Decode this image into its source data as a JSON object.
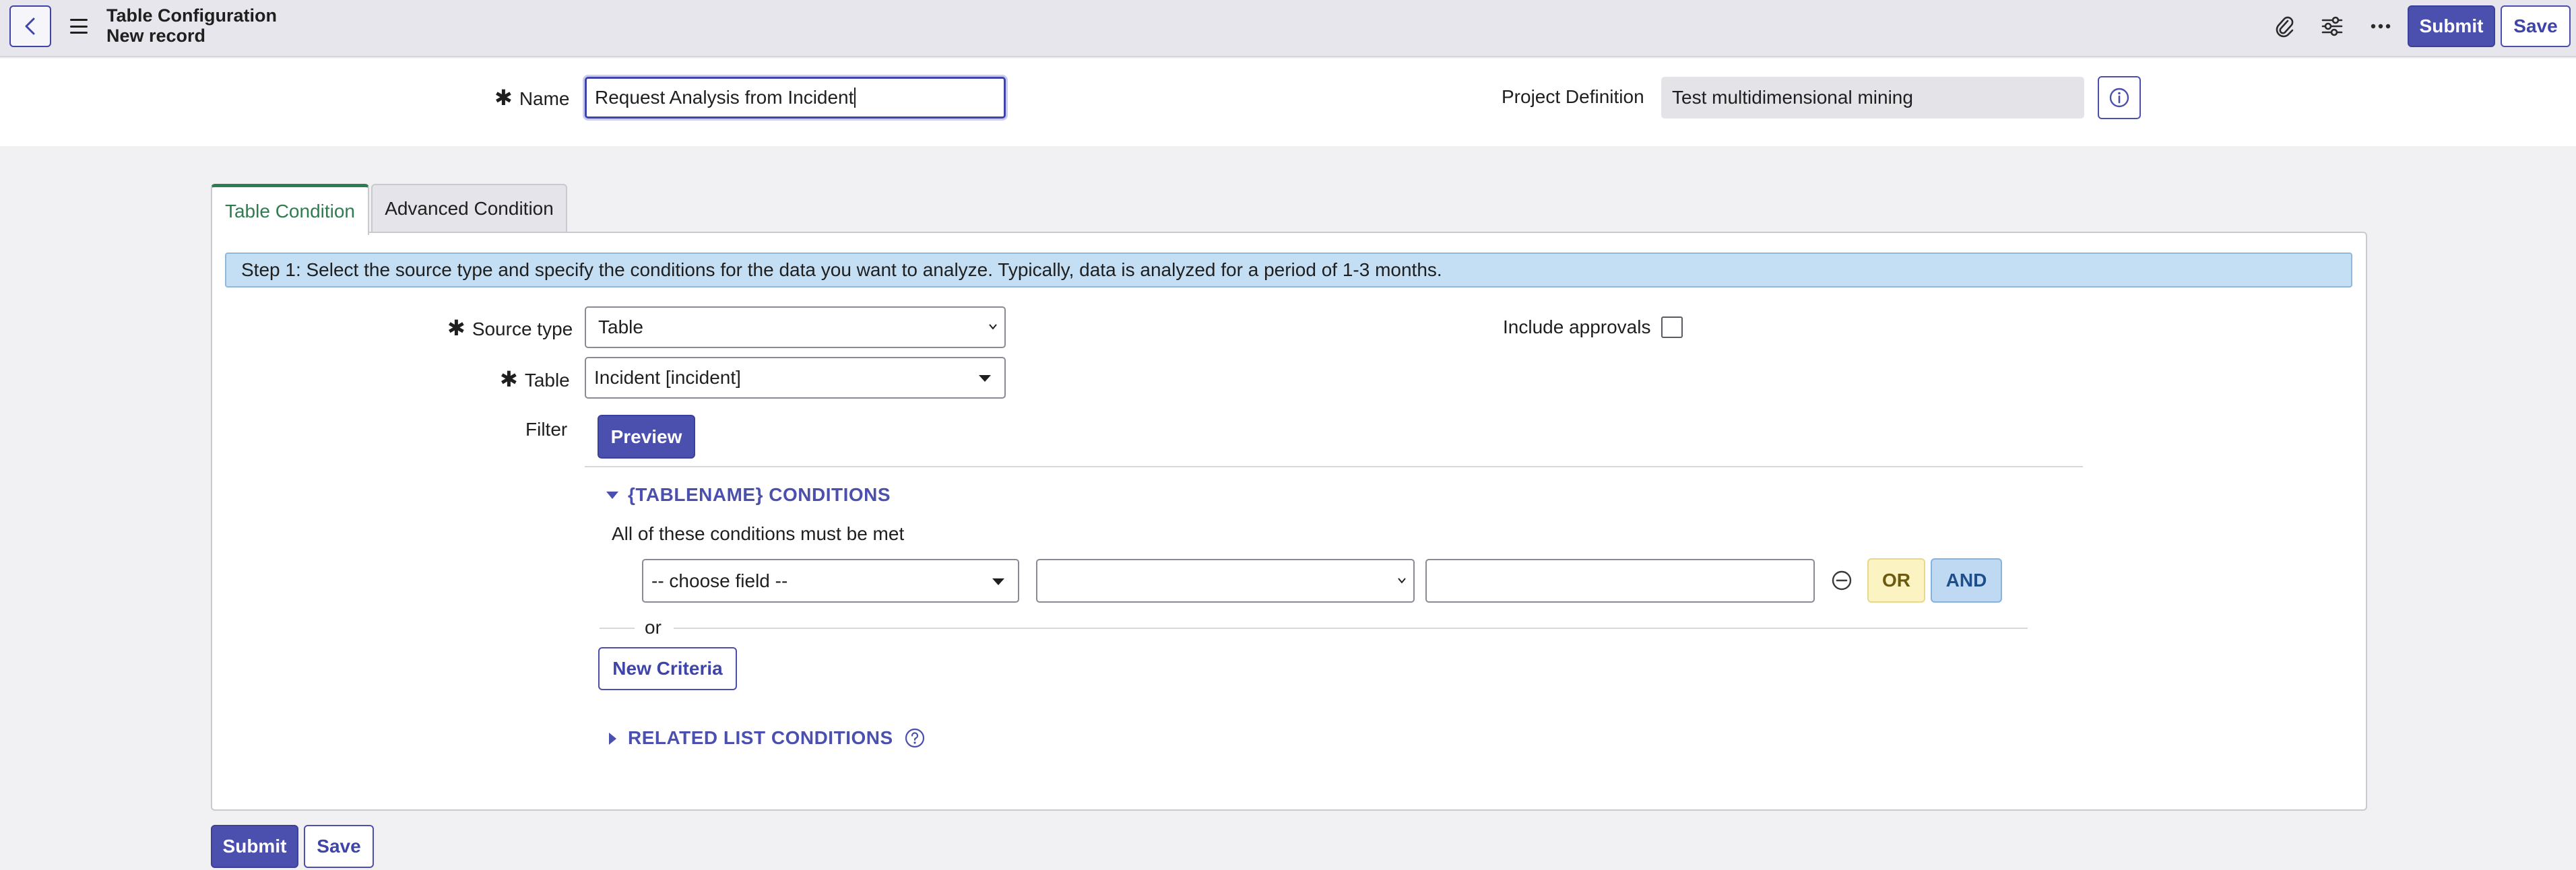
{
  "header": {
    "title": "Table Configuration",
    "subtitle": "New record",
    "icons": [
      "back-icon",
      "menu-icon",
      "attachment-icon",
      "settings-sliders-icon",
      "more-icon"
    ],
    "submit_label": "Submit",
    "save_label": "Save"
  },
  "form": {
    "name_label": "Name",
    "name_value": "Request Analysis from Incident",
    "project_label": "Project Definition",
    "project_value": "Test multidimensional mining"
  },
  "tabs": [
    {
      "label": "Table Condition",
      "active": true
    },
    {
      "label": "Advanced Condition",
      "active": false
    }
  ],
  "panel": {
    "step_text": "Step 1: Select the source type and specify the conditions for the data you want to analyze. Typically, data is analyzed for a period of 1-3 months.",
    "source_type_label": "Source type",
    "source_type_value": "Table",
    "include_approvals_label": "Include approvals",
    "include_approvals_checked": false,
    "table_label": "Table",
    "table_value": "Incident [incident]",
    "filter_label": "Filter",
    "preview_label": "Preview",
    "conditions_heading": "{TABLENAME} CONDITIONS",
    "all_conditions_text": "All of these conditions must be met",
    "choose_field_value": "-- choose field --",
    "operator_value": "",
    "value_input": "",
    "or_label": "OR",
    "and_label": "AND",
    "or_separator": "or",
    "new_criteria_label": "New Criteria",
    "related_heading": "RELATED LIST CONDITIONS"
  },
  "footer": {
    "submit_label": "Submit",
    "save_label": "Save"
  },
  "colors": {
    "primary": "#4b4fad",
    "active_tab": "#2e7d4f",
    "info_bar": "#c4def3",
    "or_bg": "#fbf3c2",
    "and_bg": "#bfd9f3"
  }
}
